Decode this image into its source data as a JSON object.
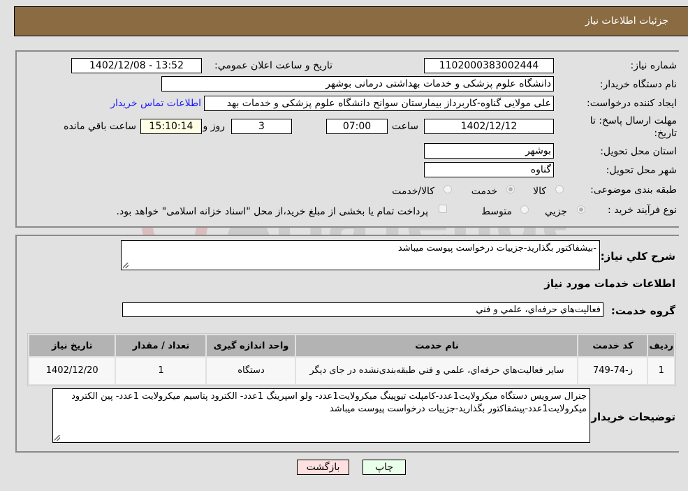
{
  "header": {
    "title": "جزئيات اطلاعات نياز"
  },
  "details": {
    "need_number": {
      "label": "شماره نياز:",
      "value": "1102000383002444"
    },
    "announce_datetime": {
      "label": "تاريخ و ساعت اعلان عمومي:",
      "value": "1402/12/08 - 13:52"
    },
    "buyer_org": {
      "label": "نام دستگاه خريدار:",
      "value": "دانشگاه علوم پزشکی و خدمات بهداشتی درمانی بوشهر"
    },
    "requester": {
      "label": "ايجاد کننده درخواست:",
      "value": "علی مولایی گناوه-کاربرداز بیمارستان سوانح دانشگاه علوم پزشکی و خدمات بهد"
    },
    "buyer_contact_link": "اطلاعات تماس خريدار",
    "deadline": {
      "label": "مهلت ارسال پاسخ: تا تاریخ:",
      "date": "1402/12/12",
      "time_label": "ساعت",
      "time": "07:00",
      "days": "3",
      "days_label": "روز و",
      "remaining": "15:10:14",
      "remaining_label": "ساعت باقي مانده"
    },
    "province": {
      "label": "استان محل تحويل:",
      "value": "بوشهر"
    },
    "city": {
      "label": "شهر محل تحويل:",
      "value": "گناوه"
    },
    "category": {
      "label": "طبقه بندی موضوعی:",
      "options": [
        "کالا",
        "خدمت",
        "کالا/خدمت"
      ],
      "selected": "خدمت"
    },
    "purchase_type": {
      "label": "نوع فرآیند خرید :",
      "options": [
        "جزيي",
        "متوسط"
      ],
      "selected": "جزيي",
      "treasury_note": "پرداخت تمام يا بخشی از مبلغ خريد،از محل \"اسناد خزانه اسلامی\" خواهد بود.",
      "treasury_checked": false
    }
  },
  "description": {
    "label": "شرح کلي نياز:",
    "value": "-بیشفاکتور بگذارید-جزییات درخواست پیوست میباشد"
  },
  "services": {
    "section_title": "اطلاعات خدمات مورد نياز",
    "group_label": "گروه خدمت:",
    "group_value": "فعاليت‌هاي حرفه‌اي، علمي و فني",
    "table": {
      "headers": [
        "رديف",
        "کد خدمت",
        "نام خدمت",
        "واحد اندازه گيری",
        "تعداد / مقدار",
        "تاريخ نياز"
      ],
      "rows": [
        [
          "1",
          "ز-74-749",
          "ساير فعاليت‌هاي حرفه‌اي، علمي و فني طبقه‌بندی‌نشده در جای ديگر",
          "دستگاه",
          "1",
          "1402/12/20"
        ]
      ]
    }
  },
  "buyer_notes": {
    "label": "توضيحات خريدار:",
    "value": "جنرال سرویس دستگاه میکرولایت1عدد-کامپلت تیوپینگ میکرولایت1عدد- ولو اسپرینگ 1عدد- الکترود پتاسیم میکرولایت 1عدد- پین الکترود میکرولایت1عدد-پیشفاکتور بگذارید-جزییات درخواست پیوست میباشد"
  },
  "buttons": {
    "print": "چاپ",
    "back": "بازگشت"
  },
  "watermark": {
    "text": "AriaTender.neT"
  }
}
